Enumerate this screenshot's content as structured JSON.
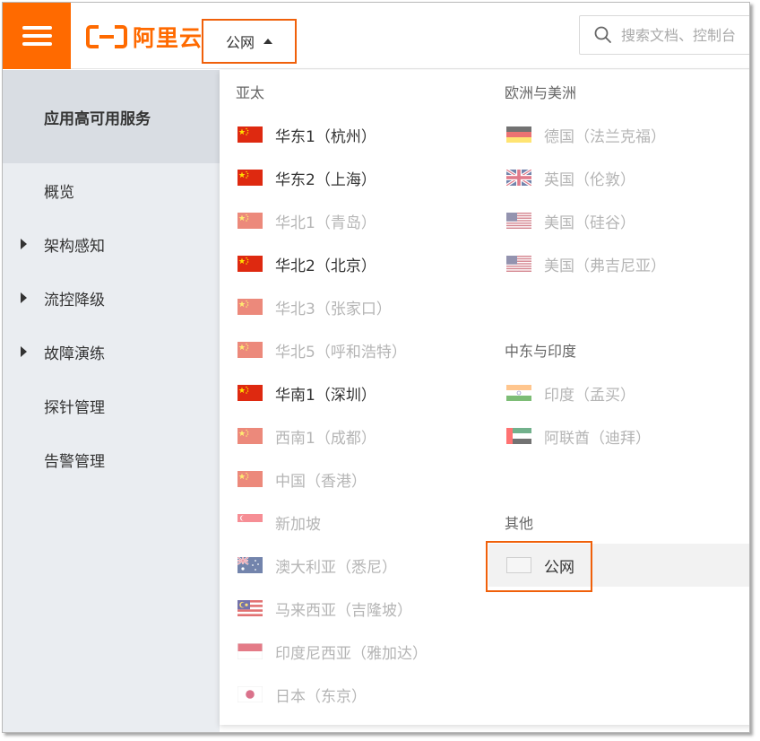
{
  "header": {
    "logo_text": "阿里云",
    "region_selector_label": "公网",
    "search_placeholder": "搜索文档、控制台"
  },
  "sidebar": {
    "title": "应用高可用服务",
    "items": [
      {
        "label": "概览",
        "expandable": false
      },
      {
        "label": "架构感知",
        "expandable": true
      },
      {
        "label": "流控降级",
        "expandable": true
      },
      {
        "label": "故障演练",
        "expandable": true
      },
      {
        "label": "探针管理",
        "expandable": false
      },
      {
        "label": "告警管理",
        "expandable": false
      }
    ]
  },
  "dropdown": {
    "asia_pacific": {
      "title": "亚太",
      "regions": [
        {
          "label": "华东1（杭州）",
          "flag": "china-flag",
          "enabled": true
        },
        {
          "label": "华东2（上海）",
          "flag": "china-flag",
          "enabled": true
        },
        {
          "label": "华北1（青岛）",
          "flag": "china-flag",
          "enabled": false
        },
        {
          "label": "华北2（北京）",
          "flag": "china-flag",
          "enabled": true
        },
        {
          "label": "华北3（张家口）",
          "flag": "china-flag",
          "enabled": false
        },
        {
          "label": "华北5（呼和浩特）",
          "flag": "china-flag",
          "enabled": false
        },
        {
          "label": "华南1（深圳）",
          "flag": "china-flag",
          "enabled": true
        },
        {
          "label": "西南1（成都）",
          "flag": "china-flag",
          "enabled": false
        },
        {
          "label": "中国（香港）",
          "flag": "china-flag",
          "enabled": false
        },
        {
          "label": "新加坡",
          "flag": "singapore-flag",
          "enabled": false
        },
        {
          "label": "澳大利亚（悉尼）",
          "flag": "australia-flag",
          "enabled": false
        },
        {
          "label": "马来西亚（吉隆坡）",
          "flag": "malaysia-flag",
          "enabled": false
        },
        {
          "label": "印度尼西亚（雅加达）",
          "flag": "indonesia-flag",
          "enabled": false
        },
        {
          "label": "日本（东京）",
          "flag": "japan-flag",
          "enabled": false
        }
      ]
    },
    "europe_americas": {
      "title": "欧洲与美洲",
      "regions": [
        {
          "label": "德国（法兰克福）",
          "flag": "germany-flag",
          "enabled": false
        },
        {
          "label": "英国（伦敦）",
          "flag": "uk-flag",
          "enabled": false
        },
        {
          "label": "美国（硅谷）",
          "flag": "usa-flag",
          "enabled": false
        },
        {
          "label": "美国（弗吉尼亚）",
          "flag": "usa-flag",
          "enabled": false
        }
      ]
    },
    "middle_east_india": {
      "title": "中东与印度",
      "regions": [
        {
          "label": "印度（孟买）",
          "flag": "india-flag",
          "enabled": false
        },
        {
          "label": "阿联酋（迪拜）",
          "flag": "uae-flag",
          "enabled": false
        }
      ]
    },
    "other": {
      "title": "其他",
      "regions": [
        {
          "label": "公网",
          "flag": "blank-flag",
          "enabled": true,
          "selected": true
        }
      ]
    }
  },
  "colors": {
    "accent": "#ff6a00",
    "highlight_border": "#f0600a",
    "sidebar_bg": "#eaedf1"
  }
}
